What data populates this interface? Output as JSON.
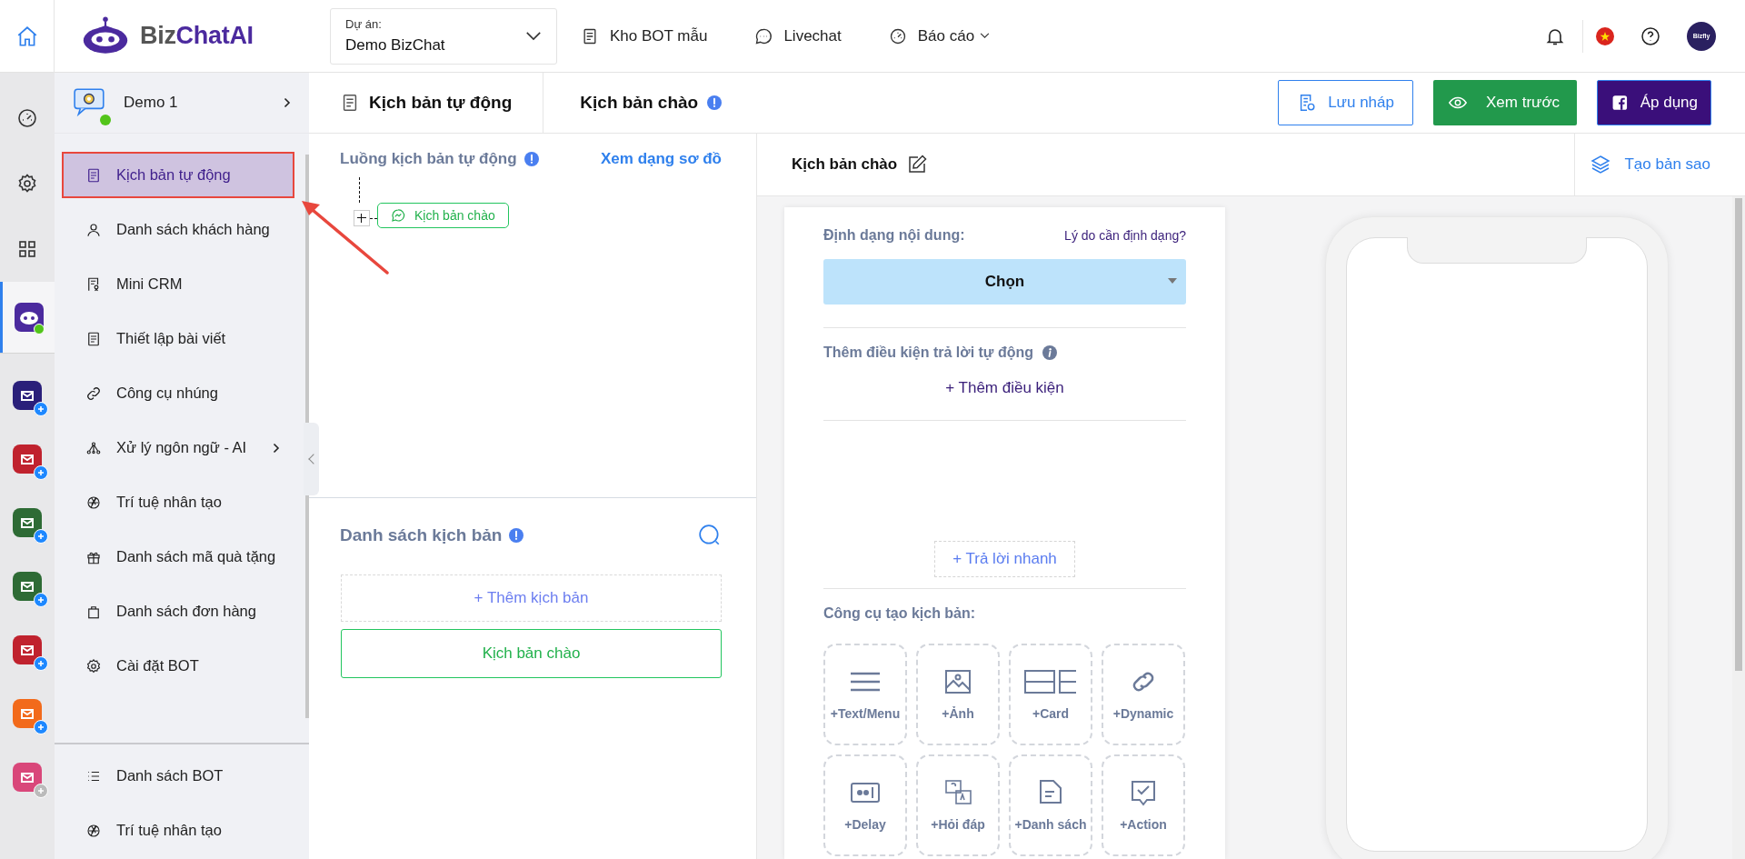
{
  "topbar": {
    "logo": {
      "first": "Biz",
      "second": "ChatAI"
    },
    "project": {
      "label": "Dự án:",
      "value": "Demo BizChat"
    },
    "nav": [
      {
        "kind": "template",
        "label": "Kho BOT mẫu",
        "dropdown": false
      },
      {
        "kind": "chat",
        "label": "Livechat",
        "dropdown": false
      },
      {
        "kind": "report",
        "label": "Báo cáo",
        "dropdown": true
      }
    ],
    "avatar_label": "Bizfly"
  },
  "rail": {
    "tools": [
      {
        "kind": "dashboard",
        "selected": false
      },
      {
        "kind": "settings",
        "selected": false
      },
      {
        "kind": "grid",
        "selected": false
      },
      {
        "kind": "bot",
        "selected": true
      }
    ],
    "apps": [
      {
        "color": "#2a1f7a",
        "enabled": true
      },
      {
        "color": "#c0222e",
        "enabled": true
      },
      {
        "color": "#2e6b35",
        "enabled": true
      },
      {
        "color": "#2e6b35",
        "enabled": true
      },
      {
        "color": "#c0222e",
        "enabled": true
      },
      {
        "color": "#f26a1b",
        "enabled": true
      },
      {
        "color": "#d9477a",
        "enabled": false
      }
    ]
  },
  "sidebar": {
    "bot_name": "Demo 1",
    "online": true,
    "items": [
      {
        "kind": "script",
        "label": "Kịch bản tự động",
        "selected": true,
        "outlined": true,
        "submenu": false
      },
      {
        "kind": "user",
        "label": "Danh sách khách hàng",
        "selected": false,
        "outlined": false,
        "submenu": false
      },
      {
        "kind": "crm",
        "label": "Mini CRM",
        "selected": false,
        "outlined": false,
        "submenu": false
      },
      {
        "kind": "post",
        "label": "Thiết lập bài viết",
        "selected": false,
        "outlined": false,
        "submenu": false
      },
      {
        "kind": "link",
        "label": "Công cụ nhúng",
        "selected": false,
        "outlined": false,
        "submenu": false
      },
      {
        "kind": "nlp",
        "label": "Xử lý ngôn ngữ - AI",
        "selected": false,
        "outlined": false,
        "submenu": true
      },
      {
        "kind": "ai",
        "label": "Trí tuệ nhân tạo",
        "selected": false,
        "outlined": false,
        "submenu": false
      },
      {
        "kind": "gift",
        "label": "Danh sách mã quà tặng",
        "selected": false,
        "outlined": false,
        "submenu": false
      },
      {
        "kind": "bag",
        "label": "Danh sách đơn hàng",
        "selected": false,
        "outlined": false,
        "submenu": false
      },
      {
        "kind": "settings",
        "label": "Cài đặt BOT",
        "selected": false,
        "outlined": false,
        "submenu": false
      }
    ],
    "bottom_items": [
      {
        "kind": "list",
        "label": "Danh sách BOT",
        "selected": false
      },
      {
        "kind": "ai",
        "label": "Trí tuệ nhân tạo",
        "selected": false
      }
    ]
  },
  "annotations": [
    {
      "kind": "arrow"
    }
  ],
  "breadcrumb": [
    {
      "label": "Kịch bản tự động",
      "icon": true,
      "info": false
    },
    {
      "label": "Kịch bản chào",
      "icon": false,
      "info": true
    }
  ],
  "actions": [
    {
      "kind": "draft",
      "label": "Lưu nháp"
    },
    {
      "kind": "preview",
      "label": "Xem trước"
    },
    {
      "kind": "apply",
      "label": "Áp dụng"
    }
  ],
  "flow": {
    "title": "Luồng kịch bản tự động",
    "view_link": "Xem dạng sơ đồ",
    "nodes": [
      {
        "label": "Kịch bản chào",
        "expanded": false
      }
    ]
  },
  "script_list": {
    "title": "Danh sách kịch bản",
    "add_label": "+ Thêm kịch bản",
    "items": [
      {
        "label": "Kịch bản chào",
        "selected": true
      }
    ]
  },
  "editor": {
    "title": "Kịch bản chào",
    "copy_label": "Tạo bản sao",
    "format_label": "Định dạng nội dung:",
    "format_help": "Lý do cần định dạng?",
    "format_select": "Chọn",
    "condition_title": "Thêm điều kiện trả lời tự động",
    "condition_add": "+ Thêm điều kiện",
    "quick_reply": "+ Trả lời nhanh",
    "tools_title": "Công cụ tạo kịch bản:",
    "tools": [
      {
        "kind": "text",
        "label": "+Text/Menu"
      },
      {
        "kind": "image",
        "label": "+Ảnh"
      },
      {
        "kind": "card",
        "label": "+Card"
      },
      {
        "kind": "dynamic",
        "label": "+Dynamic"
      },
      {
        "kind": "delay",
        "label": "+Delay"
      },
      {
        "kind": "qa",
        "label": "+Hỏi đáp"
      },
      {
        "kind": "list",
        "label": "+Danh sách"
      },
      {
        "kind": "action",
        "label": "+Action"
      }
    ]
  }
}
